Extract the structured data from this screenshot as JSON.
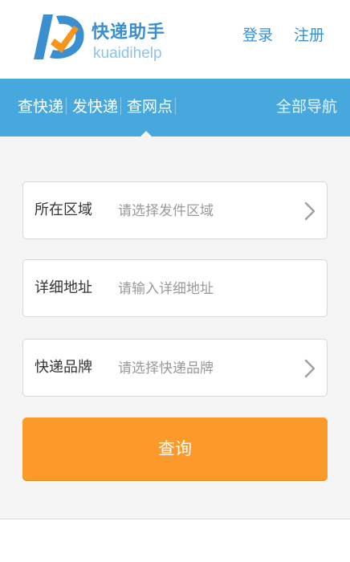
{
  "header": {
    "brand_name": "快递助手",
    "brand_sub": "kuaidihelp",
    "login_label": "登录",
    "register_label": "注册"
  },
  "nav": {
    "tabs": [
      {
        "label": "查快递"
      },
      {
        "label": "发快递"
      },
      {
        "label": "查网点"
      }
    ],
    "active_tab": "查网点",
    "all_nav_label": "全部导航"
  },
  "form": {
    "fields": [
      {
        "label": "所在区域",
        "placeholder": "请选择发件区域",
        "icon": "chevron-right-icon"
      },
      {
        "label": "详细地址",
        "placeholder": "请输入详细地址"
      },
      {
        "label": "快递品牌",
        "placeholder": "请选择快递品牌",
        "icon": "chevron-right-icon"
      }
    ],
    "submit_label": "查询"
  },
  "colors": {
    "brand_blue": "#3a8fd0",
    "nav_blue": "#46a8dc",
    "submit_orange": "#fb9a2a",
    "logo_orange": "#f7941d"
  }
}
